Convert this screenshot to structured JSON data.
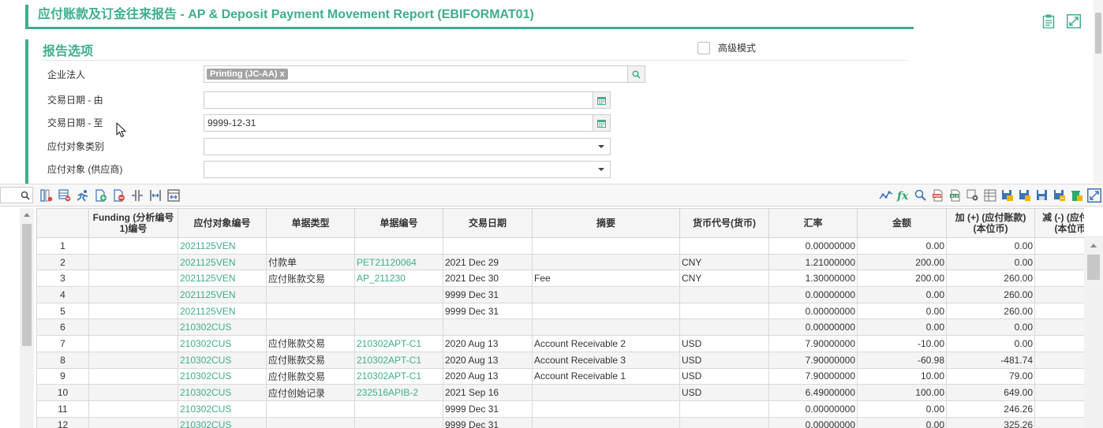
{
  "title": "应付账款及订金往来报告 - AP & Deposit Payment Movement Report (EBIFORMAT01)",
  "top_icons": [
    "clipboard-icon",
    "expand-icon"
  ],
  "options": {
    "title": "报告选项",
    "advanced_mode_label": "高级模式",
    "advanced_mode_checked": false,
    "fields": {
      "entity": {
        "label": "企业法人",
        "tag": "Printing (JC-AA)",
        "tag_remove": "x"
      },
      "date_from": {
        "label": "交易日期 - 由",
        "value": ""
      },
      "date_to": {
        "label": "交易日期 - 至",
        "value": "9999-12-31"
      },
      "payee_type": {
        "label": "应付对象类别",
        "value": ""
      },
      "payee": {
        "label": "应付对象 (供应商)",
        "value": ""
      }
    }
  },
  "toolbar": {
    "left_icons": [
      "column-chooser-icon",
      "delete-column-icon",
      "run-icon",
      "add-row-icon",
      "delete-row-icon",
      "split-column-icon",
      "fit-column-icon",
      "resize-column-icon"
    ],
    "right_icons": [
      "chart-icon",
      "formula-icon",
      "zoom-icon",
      "export-pdf-icon",
      "export-excel-icon",
      "settings-icon",
      "print-icon",
      "save-layout-icon",
      "save-as-icon",
      "save-icon",
      "save-all-icon",
      "clear-icon",
      "fullscreen-icon"
    ]
  },
  "grid": {
    "columns": [
      {
        "h1": "",
        "h2": ""
      },
      {
        "h1": "Funding (分析编号",
        "h2": "1)编号"
      },
      {
        "h1": "应付对象编号",
        "h2": ""
      },
      {
        "h1": "单据类型",
        "h2": ""
      },
      {
        "h1": "单据编号",
        "h2": ""
      },
      {
        "h1": "交易日期",
        "h2": ""
      },
      {
        "h1": "摘要",
        "h2": ""
      },
      {
        "h1": "货币代号(货币)",
        "h2": ""
      },
      {
        "h1": "汇率",
        "h2": ""
      },
      {
        "h1": "金额",
        "h2": ""
      },
      {
        "h1": "加 (+) (应付账款)",
        "h2": "(本位币)"
      },
      {
        "h1": "减 (-) (应付账",
        "h2": "(本位币"
      }
    ],
    "rows": [
      [
        "1",
        "",
        "2021125VEN",
        "",
        "",
        "",
        "",
        "",
        "0.00000000",
        "0.00",
        "0.00",
        ""
      ],
      [
        "2",
        "",
        "2021125VEN",
        "付款单",
        "PET21120064",
        "2021 Dec 29",
        "",
        "CNY",
        "1.21000000",
        "200.00",
        "0.00",
        ""
      ],
      [
        "3",
        "",
        "2021125VEN",
        "应付账款交易",
        "AP_211230",
        "2021 Dec 30",
        "Fee",
        "CNY",
        "1.30000000",
        "200.00",
        "260.00",
        ""
      ],
      [
        "4",
        "",
        "2021125VEN",
        "",
        "",
        "9999 Dec 31",
        "",
        "",
        "0.00000000",
        "0.00",
        "260.00",
        ""
      ],
      [
        "5",
        "",
        "2021125VEN",
        "",
        "",
        "9999 Dec 31",
        "",
        "",
        "0.00000000",
        "0.00",
        "260.00",
        ""
      ],
      [
        "6",
        "",
        "210302CUS",
        "",
        "",
        "",
        "",
        "",
        "0.00000000",
        "0.00",
        "0.00",
        ""
      ],
      [
        "7",
        "",
        "210302CUS",
        "应付账款交易",
        "210302APT-C1",
        "2020 Aug 13",
        "Account Receivable 2",
        "USD",
        "7.90000000",
        "-10.00",
        "0.00",
        ""
      ],
      [
        "8",
        "",
        "210302CUS",
        "应付账款交易",
        "210302APT-C1",
        "2020 Aug 13",
        "Account Receivable 3",
        "USD",
        "7.90000000",
        "-60.98",
        "-481.74",
        ""
      ],
      [
        "9",
        "",
        "210302CUS",
        "应付账款交易",
        "210302APT-C1",
        "2020 Aug 13",
        "Account Receivable 1",
        "USD",
        "7.90000000",
        "10.00",
        "79.00",
        ""
      ],
      [
        "10",
        "",
        "210302CUS",
        "应付创始记录",
        "232516APIB-2",
        "2021 Sep 16",
        "",
        "USD",
        "6.49000000",
        "100.00",
        "649.00",
        ""
      ],
      [
        "11",
        "",
        "210302CUS",
        "",
        "",
        "9999 Dec 31",
        "",
        "",
        "0.00000000",
        "0.00",
        "246.26",
        ""
      ],
      [
        "12",
        "",
        "210302CUS",
        "",
        "",
        "9999 Dec 31",
        "",
        "",
        "0.00000000",
        "0.00",
        "325.26",
        ""
      ]
    ]
  }
}
